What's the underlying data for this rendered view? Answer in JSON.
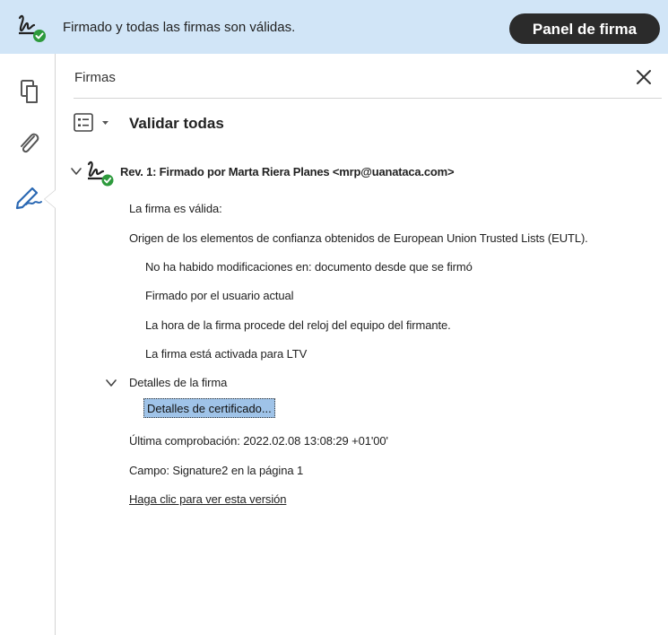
{
  "banner": {
    "status_text": "Firmado y todas las firmas son válidas.",
    "panel_button_label": "Panel de firma"
  },
  "panel": {
    "title": "Firmas",
    "validate_all_label": "Validar todas"
  },
  "signature": {
    "title": "Rev. 1: Firmado por Marta Riera Planes <mrp@uanataca.com>",
    "valid_text": "La firma es válida:",
    "trust_origin": "Origen de los elementos de confianza obtenidos de European Union Trusted Lists (EUTL).",
    "checks": [
      "No ha habido modificaciones en: documento desde que se firmó",
      "Firmado por el usuario actual",
      "La hora de la firma procede del reloj del equipo del firmante.",
      "La firma está activada para LTV"
    ],
    "details_label": "Detalles de la firma",
    "cert_details_label": "Detalles de certificado...",
    "last_check": "Última comprobación: 2022.02.08 13:08:29 +01'00'",
    "field": "Campo: Signature2 en la página 1",
    "view_version_link": "Haga clic para ver esta versión"
  },
  "colors": {
    "banner_bg": "#d1e5f7",
    "button_dark": "#2b2b2b",
    "valid_green": "#2d9a3c",
    "selection_blue": "#9fc3e8"
  },
  "icons": {
    "banner": "signature-valid-icon",
    "rail": [
      "pages-icon",
      "attachment-icon",
      "signature-pen-icon"
    ],
    "close": "close-icon",
    "options": "list-options-icon",
    "chevron": "chevron-down-icon"
  }
}
